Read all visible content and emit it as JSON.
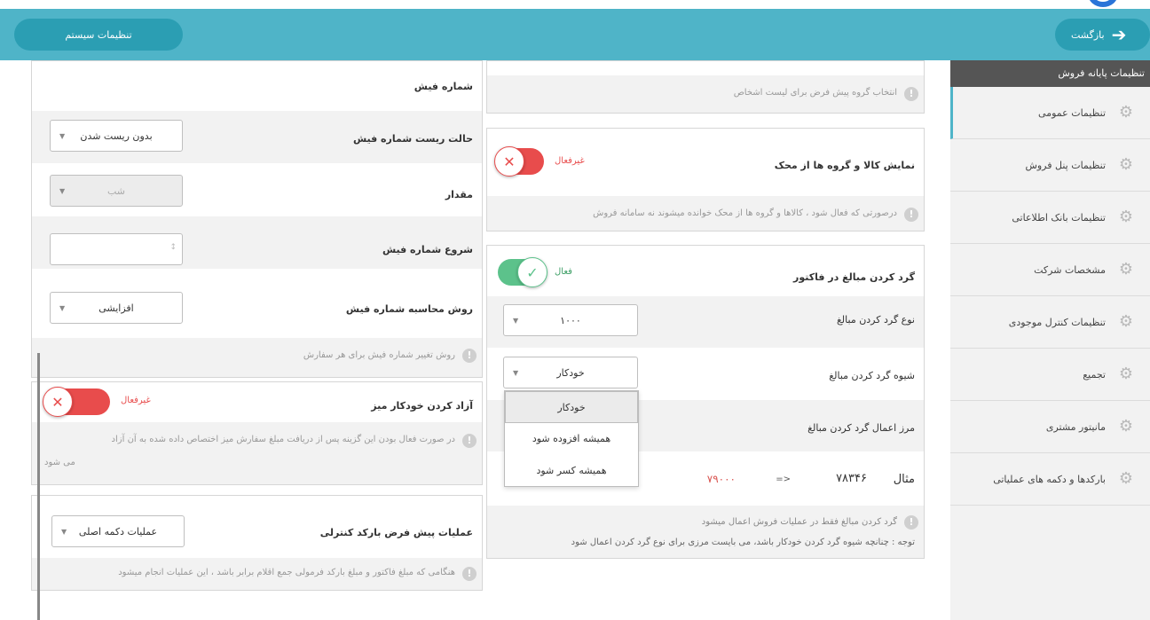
{
  "header": {
    "back_label": "بازگشت",
    "system_settings_label": "تنظیمات سیستم"
  },
  "sidebar": {
    "title": "تنظیمات پایانه فروش",
    "items": [
      {
        "label": "تنظیمات عمومی"
      },
      {
        "label": "تنظیمات پنل فروش"
      },
      {
        "label": "تنظیمات بانک اطلاعاتی"
      },
      {
        "label": "مشخصات شرکت"
      },
      {
        "label": "تنظیمات کنترل موجودی"
      },
      {
        "label": "تجمیع"
      },
      {
        "label": "مانیتور مشتری"
      },
      {
        "label": "بارکدها و دکمه های عملیاتی"
      }
    ]
  },
  "middle": {
    "customer_group_hint": "انتخاب گروه پیش فرض برای لیست اشخاص",
    "scale_panel": {
      "label": "نمایش کالا و گروه ها از محک",
      "toggle_text": "غیرفعال",
      "hint": "درصورتی که فعال شود ، کالاها و گروه ها از محک خوانده میشوند نه سامانه فروش"
    },
    "rounding_panel": {
      "label": "گرد کردن مبالغ در فاکتور",
      "toggle_text": "فعال",
      "type_label": "نوع گرد کردن مبالغ",
      "type_value": "۱۰۰۰",
      "method_label": "شیوه گرد کردن مبالغ",
      "method_value": "خودکار",
      "threshold_label": "مرز اعمال گرد کردن مبالغ",
      "example_label": "مثال",
      "example_input": "۷۸۳۴۶",
      "example_arrow": "=>",
      "example_result": "۷۹۰۰۰",
      "hint_1": "گرد کردن مبالغ فقط در عملیات فروش اعمال میشود",
      "hint_2": "توجه : چنانچه شیوه گرد کردن خودکار باشد، می بایست مرزی برای نوع گرد کردن اعمال شود"
    },
    "method_dropdown": {
      "options": [
        "خودکار",
        "همیشه افزوده شود",
        "همیشه کسر شود"
      ],
      "selected_index": 0
    }
  },
  "left": {
    "receipt_panel": {
      "title": "شماره فیش",
      "reset_label": "حالت ریست شماره فیش",
      "reset_value": "بدون ریست شدن",
      "amount_label": "مقدار",
      "amount_value": "شب",
      "start_label": "شروع شماره فیش",
      "start_value": "",
      "calc_label": "روش محاسبه شماره فیش",
      "calc_value": "افزایشی",
      "hint": "روش تغییر شماره فیش برای هر سفارش"
    },
    "table_panel": {
      "label": "آزاد کردن خودکار میز",
      "toggle_text": "غیرفعال",
      "hint_line_1": "در صورت فعال بودن این گزینه پس از دریافت مبلغ سفارش میز اختصاص داده شده به آن آزاد",
      "hint_line_2": "می شود"
    },
    "barcode_panel": {
      "label": "عملیات پیش فرض بارکد کنترلی",
      "value": "عملیات دکمه اصلی",
      "hint": "هنگامی که مبلغ فاکتور و مبلغ بارکد فرمولی جمع اقلام برابر باشد ، این عملیات انجام میشود"
    }
  },
  "colors": {
    "header": "#4fb4c8",
    "header_button": "#2b9eb3",
    "toggle_off": "#e84c4c",
    "toggle_on": "#5cc28b",
    "sidebar_title_bg": "#555555"
  }
}
